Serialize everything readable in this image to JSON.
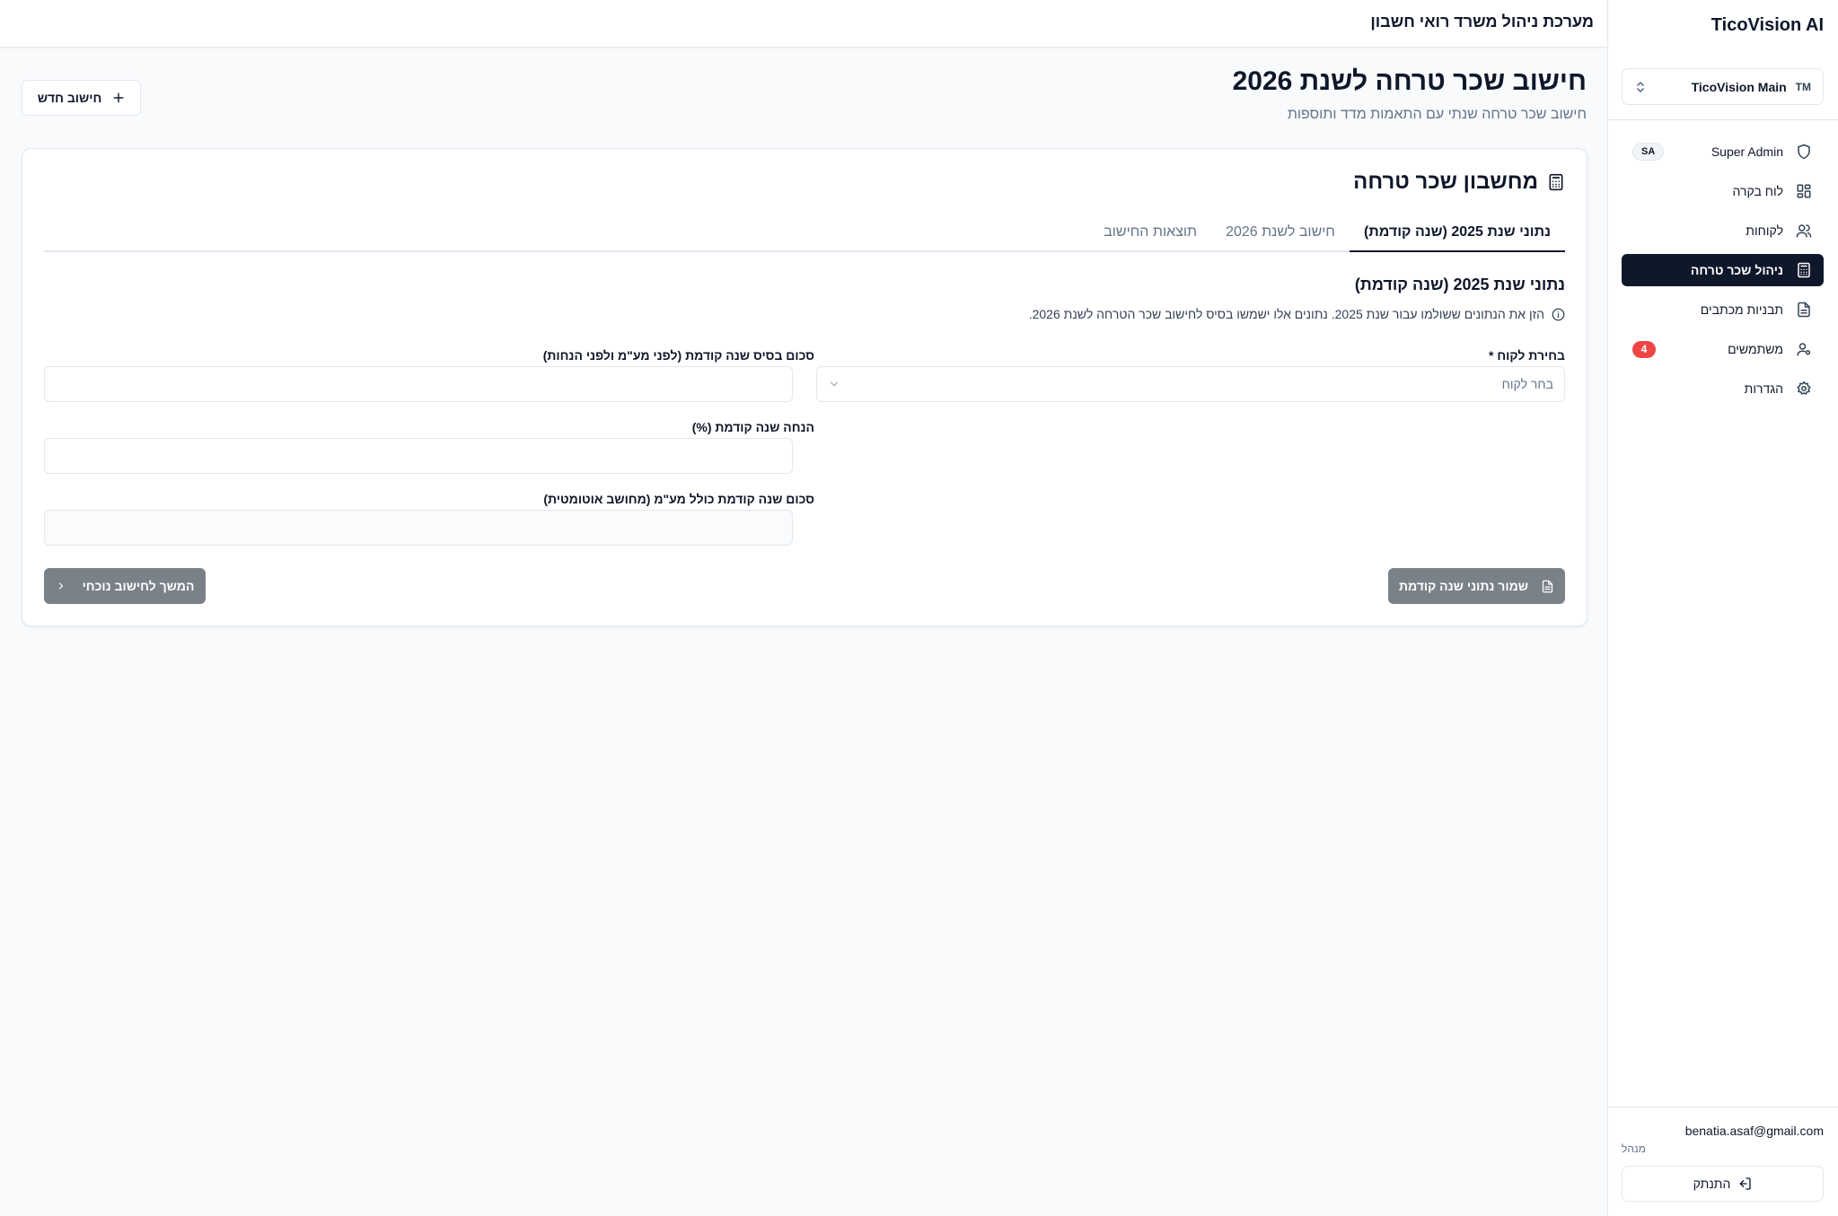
{
  "app": {
    "brand": "TicoVision AI",
    "header_title": "מערכת ניהול משרד רואי חשבון"
  },
  "tenant": {
    "initials": "TM",
    "name": "TicoVision Main"
  },
  "sidebar": {
    "items": [
      {
        "label": "Super Admin",
        "icon": "shield-icon",
        "badge": "SA",
        "active": false
      },
      {
        "label": "לוח בקרה",
        "icon": "dashboard-icon",
        "active": false
      },
      {
        "label": "לקוחות",
        "icon": "users-icon",
        "active": false
      },
      {
        "label": "ניהול שכר טרחה",
        "icon": "calculator-icon",
        "active": true
      },
      {
        "label": "תבניות מכתבים",
        "icon": "document-icon",
        "active": false
      },
      {
        "label": "משתמשים",
        "icon": "user-cog-icon",
        "badge": "4",
        "active": false
      },
      {
        "label": "הגדרות",
        "icon": "gear-icon",
        "active": false
      }
    ],
    "user_email": "benatia.asaf@gmail.com",
    "user_role": "מנהל",
    "logout_label": "התנתק"
  },
  "page": {
    "title": "חישוב שכר טרחה לשנת 2026",
    "subtitle": "חישוב שכר טרחה שנתי עם התאמות מדד ותוספות",
    "new_calc_label": "חישוב חדש"
  },
  "card": {
    "title": "מחשבון שכר טרחה",
    "tabs": [
      {
        "label": "נתוני שנת 2025 (שנה קודמת)",
        "active": true
      },
      {
        "label": "חישוב לשנת 2026",
        "active": false
      },
      {
        "label": "תוצאות החישוב",
        "active": false
      }
    ],
    "section_title": "נתוני שנת 2025 (שנה קודמת)",
    "section_desc": "הזן את הנתונים ששולמו עבור שנת 2025. נתונים אלו ישמשו בסיס לחישוב שכר הטרחה לשנת 2026.",
    "fields": {
      "client_label": "בחירת לקוח *",
      "client_placeholder": "בחר לקוח",
      "base_amount_label": "סכום בסיס שנה קודמת (לפני מע\"מ ולפני הנחות)",
      "base_amount_value": "",
      "discount_label": "הנחה שנה קודמת (%)",
      "discount_value": "",
      "total_with_vat_label": "סכום שנה קודמת כולל מע\"מ (מחושב אוטומטית)",
      "total_with_vat_value": ""
    },
    "save_label": "שמור נתוני שנה קודמת",
    "next_label": "המשך לחישוב נוכחי"
  },
  "colors": {
    "active_nav_bg": "#0f172a",
    "badge_red": "#ef4444",
    "disabled_button": "#7b8189"
  }
}
